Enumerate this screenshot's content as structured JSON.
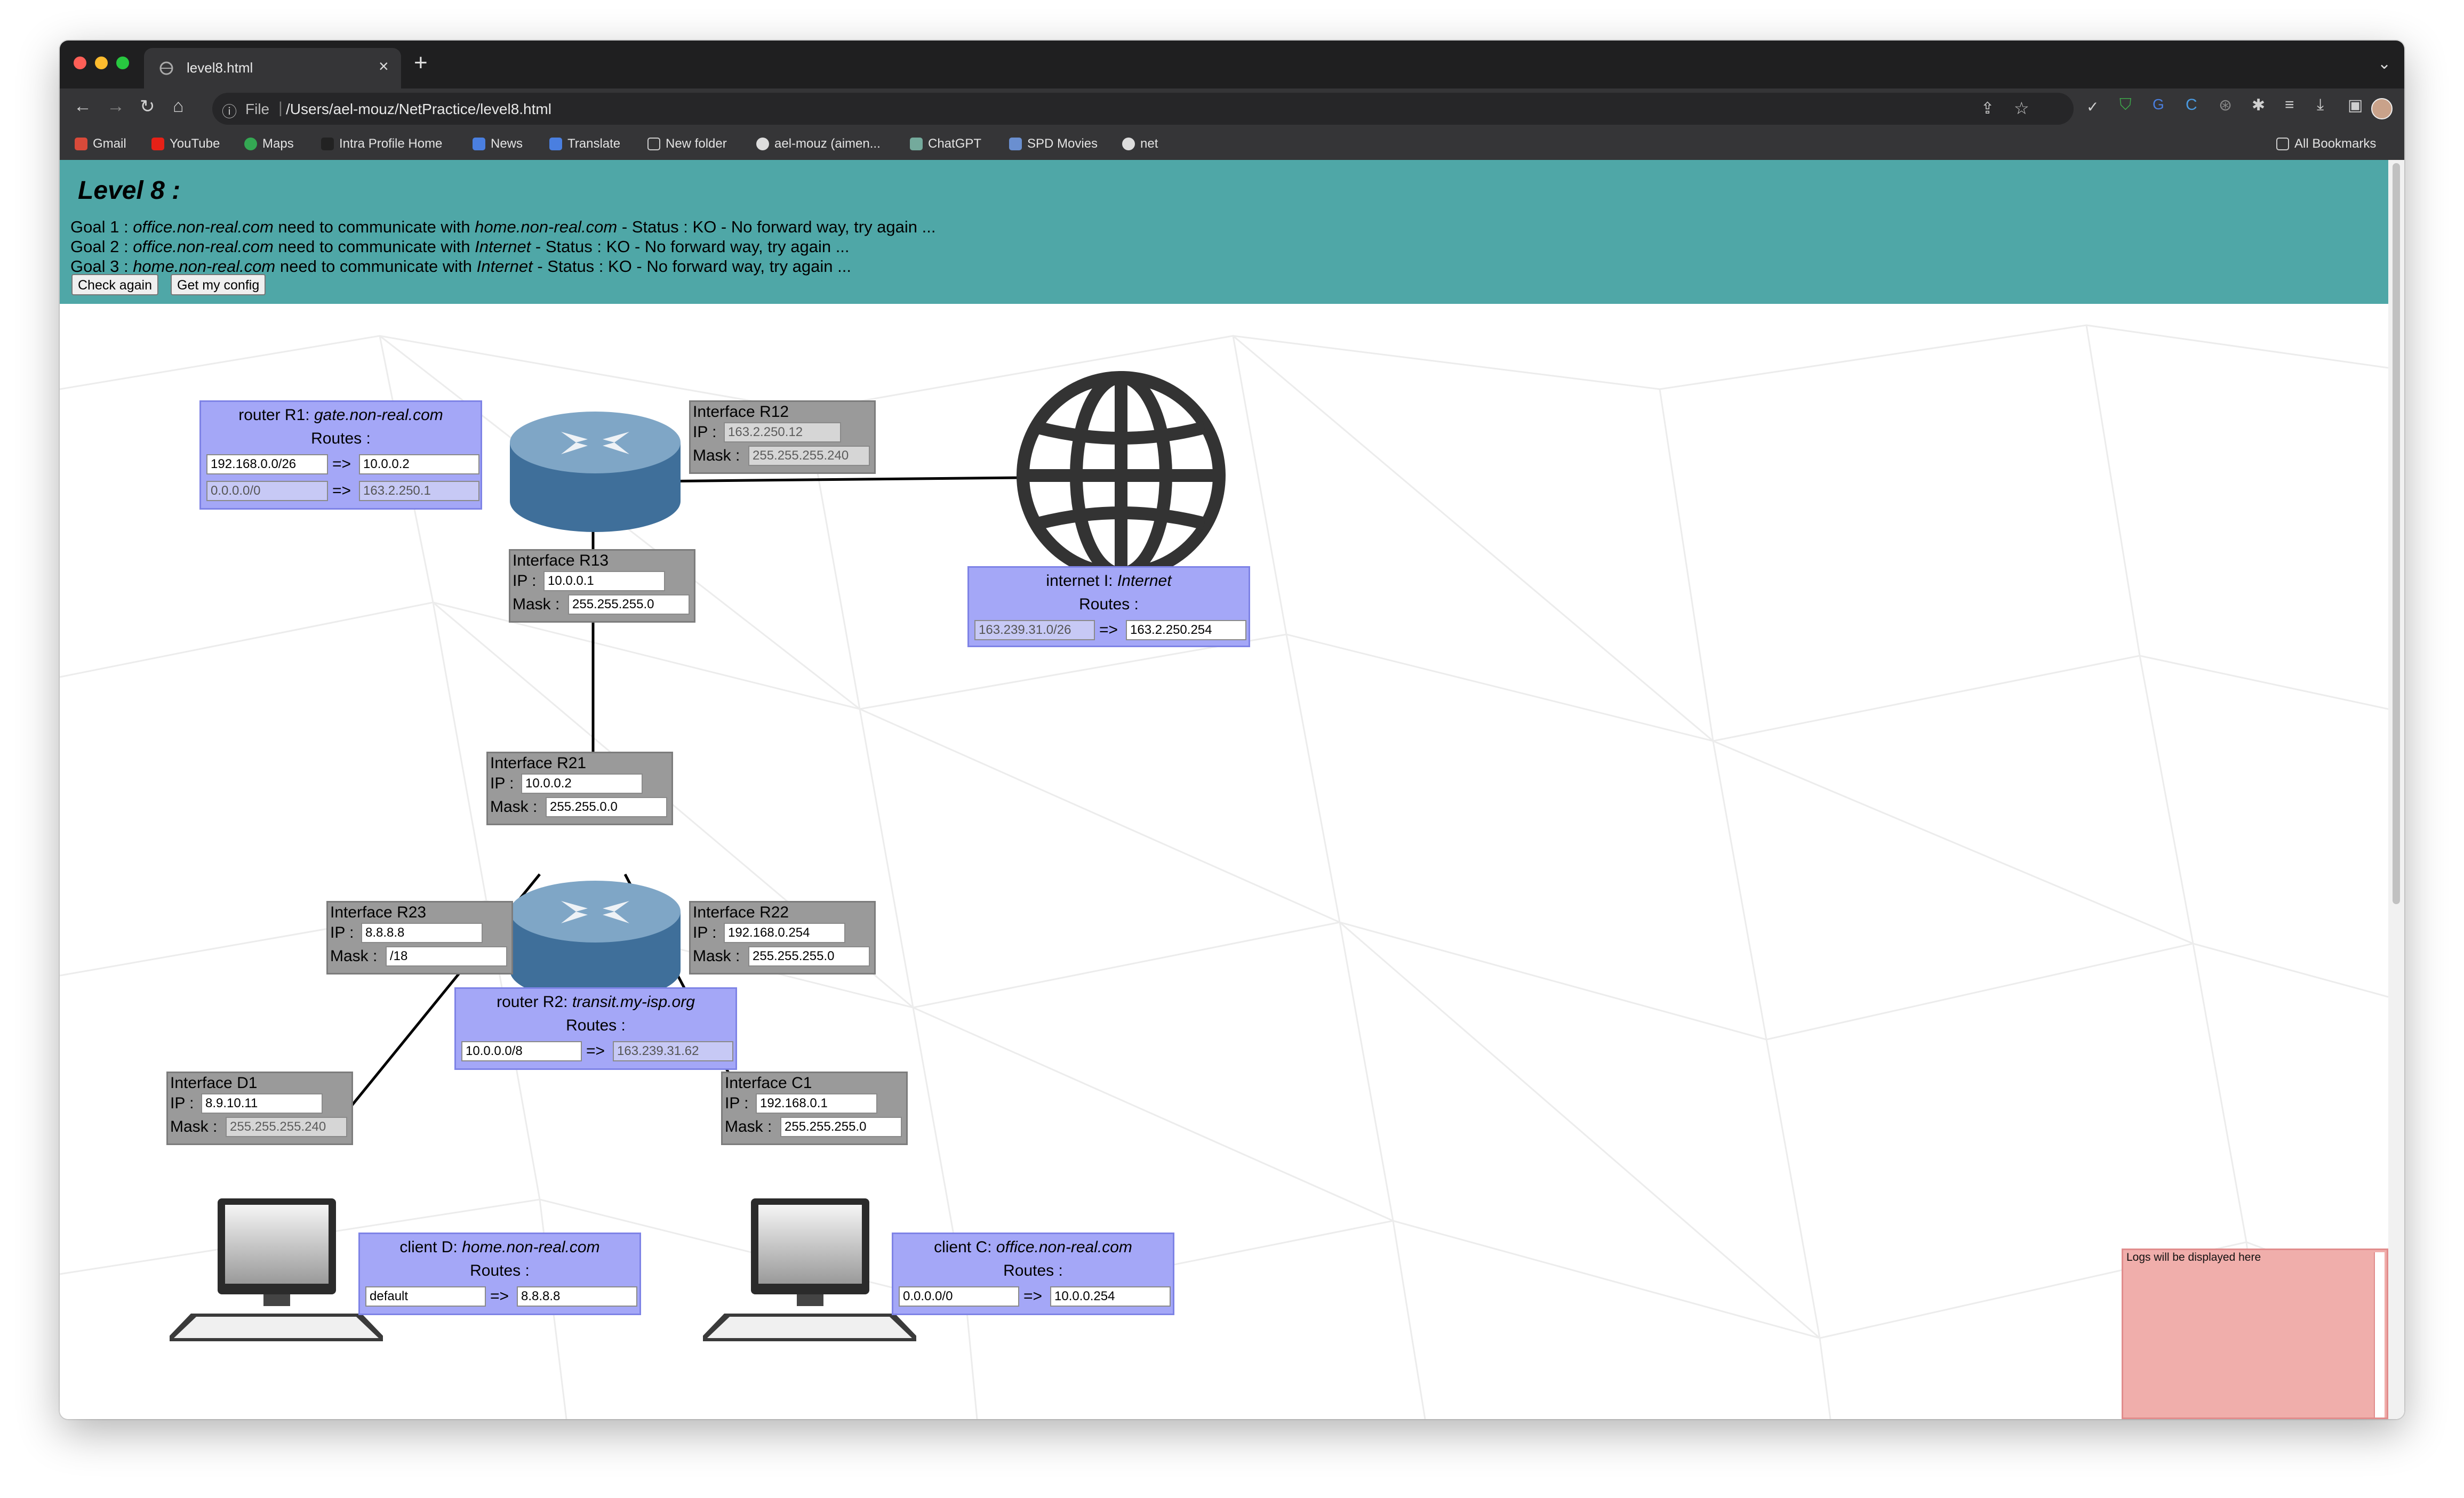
{
  "browser": {
    "tab_title": "level8.html",
    "url_prefix": "File",
    "url": "/Users/ael-mouz/NetPractice/level8.html",
    "bookmarks": [
      "Gmail",
      "YouTube",
      "Maps",
      "Intra Profile Home",
      "News",
      "Translate",
      "New folder",
      "ael-mouz (aimen...",
      "ChatGPT",
      "SPD Movies",
      "net"
    ],
    "all_bookmarks": "All Bookmarks"
  },
  "header": {
    "level_title": "Level 8 :",
    "goals": [
      {
        "prefix": "Goal 1 : ",
        "src": "office.non-real.com",
        "mid": " need to communicate with ",
        "dst": "home.non-real.com",
        "status": " - Status : KO - No forward way, try again ..."
      },
      {
        "prefix": "Goal 2 : ",
        "src": "office.non-real.com",
        "mid": " need to communicate with ",
        "dst": "Internet",
        "status": " - Status : KO - No forward way, try again ..."
      },
      {
        "prefix": "Goal 3 : ",
        "src": "home.non-real.com",
        "mid": " need to communicate with ",
        "dst": "Internet",
        "status": " - Status : KO - No forward way, try again ..."
      }
    ],
    "check_button": "Check again",
    "config_button": "Get my config"
  },
  "labels": {
    "routes": "Routes :",
    "ip": "IP :",
    "mask": "Mask :",
    "arrow": "=>"
  },
  "router_r1": {
    "title_prefix": "router R1: ",
    "title_name": "gate.non-real.com",
    "routes": [
      {
        "dest": "192.168.0.0/26",
        "next": "10.0.0.2"
      },
      {
        "dest": "0.0.0.0/0",
        "next": "163.2.250.1"
      }
    ]
  },
  "interface_r12": {
    "title": "Interface R12",
    "ip": "163.2.250.12",
    "mask": "255.255.255.240"
  },
  "interface_r13": {
    "title": "Interface R13",
    "ip": "10.0.0.1",
    "mask": "255.255.255.0"
  },
  "internet": {
    "title_prefix": "internet I: ",
    "title_name": "Internet",
    "routes": [
      {
        "dest": "163.239.31.0/26",
        "next": "163.2.250.254"
      }
    ]
  },
  "interface_r21": {
    "title": "Interface R21",
    "ip": "10.0.0.2",
    "mask": "255.255.0.0"
  },
  "interface_r23": {
    "title": "Interface R23",
    "ip": "8.8.8.8",
    "mask": "/18"
  },
  "interface_r22": {
    "title": "Interface R22",
    "ip": "192.168.0.254",
    "mask": "255.255.255.0"
  },
  "router_r2": {
    "title_prefix": "router R2: ",
    "title_name": "transit.my-isp.org",
    "routes": [
      {
        "dest": "10.0.0.0/8",
        "next": "163.239.31.62"
      }
    ]
  },
  "interface_d1": {
    "title": "Interface D1",
    "ip": "8.9.10.11",
    "mask": "255.255.255.240"
  },
  "interface_c1": {
    "title": "Interface C1",
    "ip": "192.168.0.1",
    "mask": "255.255.255.0"
  },
  "client_d": {
    "title_prefix": "client D: ",
    "title_name": "home.non-real.com",
    "routes": [
      {
        "dest": "default",
        "next": "8.8.8.8"
      }
    ]
  },
  "client_c": {
    "title_prefix": "client C: ",
    "title_name": "office.non-real.com",
    "routes": [
      {
        "dest": "0.0.0.0/0",
        "next": "10.0.0.254"
      }
    ]
  },
  "logs": {
    "placeholder": "Logs will be displayed here"
  },
  "colors": {
    "header_bg": "#4fa7a7",
    "host_box": "#a4a7f7",
    "interface_box": "#9a9a9a",
    "logs_bg": "#f0aeab",
    "router_top": "#7fa6c6",
    "router_side": "#3f6f9a"
  }
}
